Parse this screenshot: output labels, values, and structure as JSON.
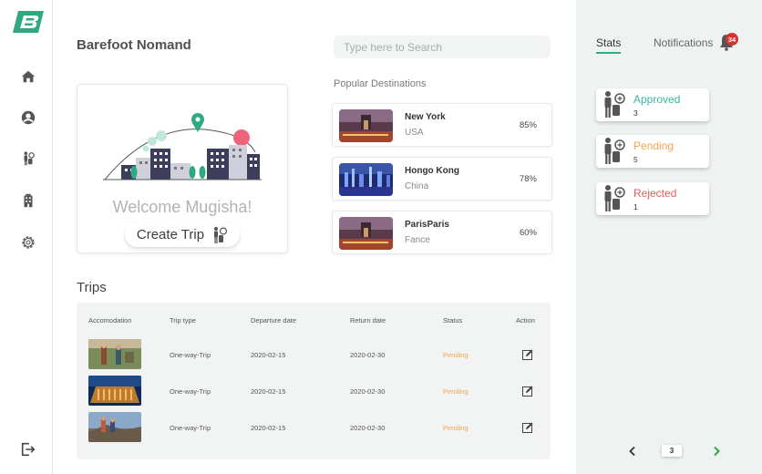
{
  "app": {
    "title": "Barefoot Nomand"
  },
  "search": {
    "placeholder": "Type here to Search"
  },
  "sidebar": {
    "items": [
      {
        "name": "home-icon"
      },
      {
        "name": "profile-icon"
      },
      {
        "name": "traveler-icon"
      },
      {
        "name": "building-icon"
      },
      {
        "name": "settings-icon"
      }
    ],
    "logout": "logout-icon"
  },
  "welcome": {
    "greeting": "Welcome Mugisha!",
    "create_trip_label": "Create Trip"
  },
  "popular": {
    "title": "Popular Destinations",
    "items": [
      {
        "city": "New York",
        "country": "USA",
        "percent": "85%"
      },
      {
        "city": "Hongo Kong",
        "country": "China",
        "percent": "78%"
      },
      {
        "city": "ParisParis",
        "country": "Fance",
        "percent": "60%"
      }
    ]
  },
  "trips": {
    "title": "Trips",
    "columns": [
      "Accomodation",
      "Trip type",
      "Departure date",
      "Return date",
      "Status",
      "Action"
    ],
    "rows": [
      {
        "trip_type": "One-way-Trip",
        "departure": "2020-02-15",
        "return": "2020-02-30",
        "status": "Pending"
      },
      {
        "trip_type": "One-way-Trip",
        "departure": "2020-02-15",
        "return": "2020-02-30",
        "status": "Pending"
      },
      {
        "trip_type": "One-way-Trip",
        "departure": "2020-02-15",
        "return": "2020-02-30",
        "status": "Pending"
      }
    ]
  },
  "right_panel": {
    "tabs": {
      "stats": "Stats",
      "notifications": "Notifications"
    },
    "notification_count": "34",
    "stats": [
      {
        "label": "Approved",
        "count": "3",
        "color": "#3bb3a0"
      },
      {
        "label": "Pending",
        "count": "5",
        "color": "#f2a64e"
      },
      {
        "label": "Rejected",
        "count": "1",
        "color": "#e05a5a"
      }
    ],
    "pagination": {
      "current_page": "3"
    }
  },
  "colors": {
    "brand_green": "#2eaa7e",
    "pending": "#f2a64e",
    "panel_bg": "#eef2f0",
    "badge_red": "#d63333"
  }
}
